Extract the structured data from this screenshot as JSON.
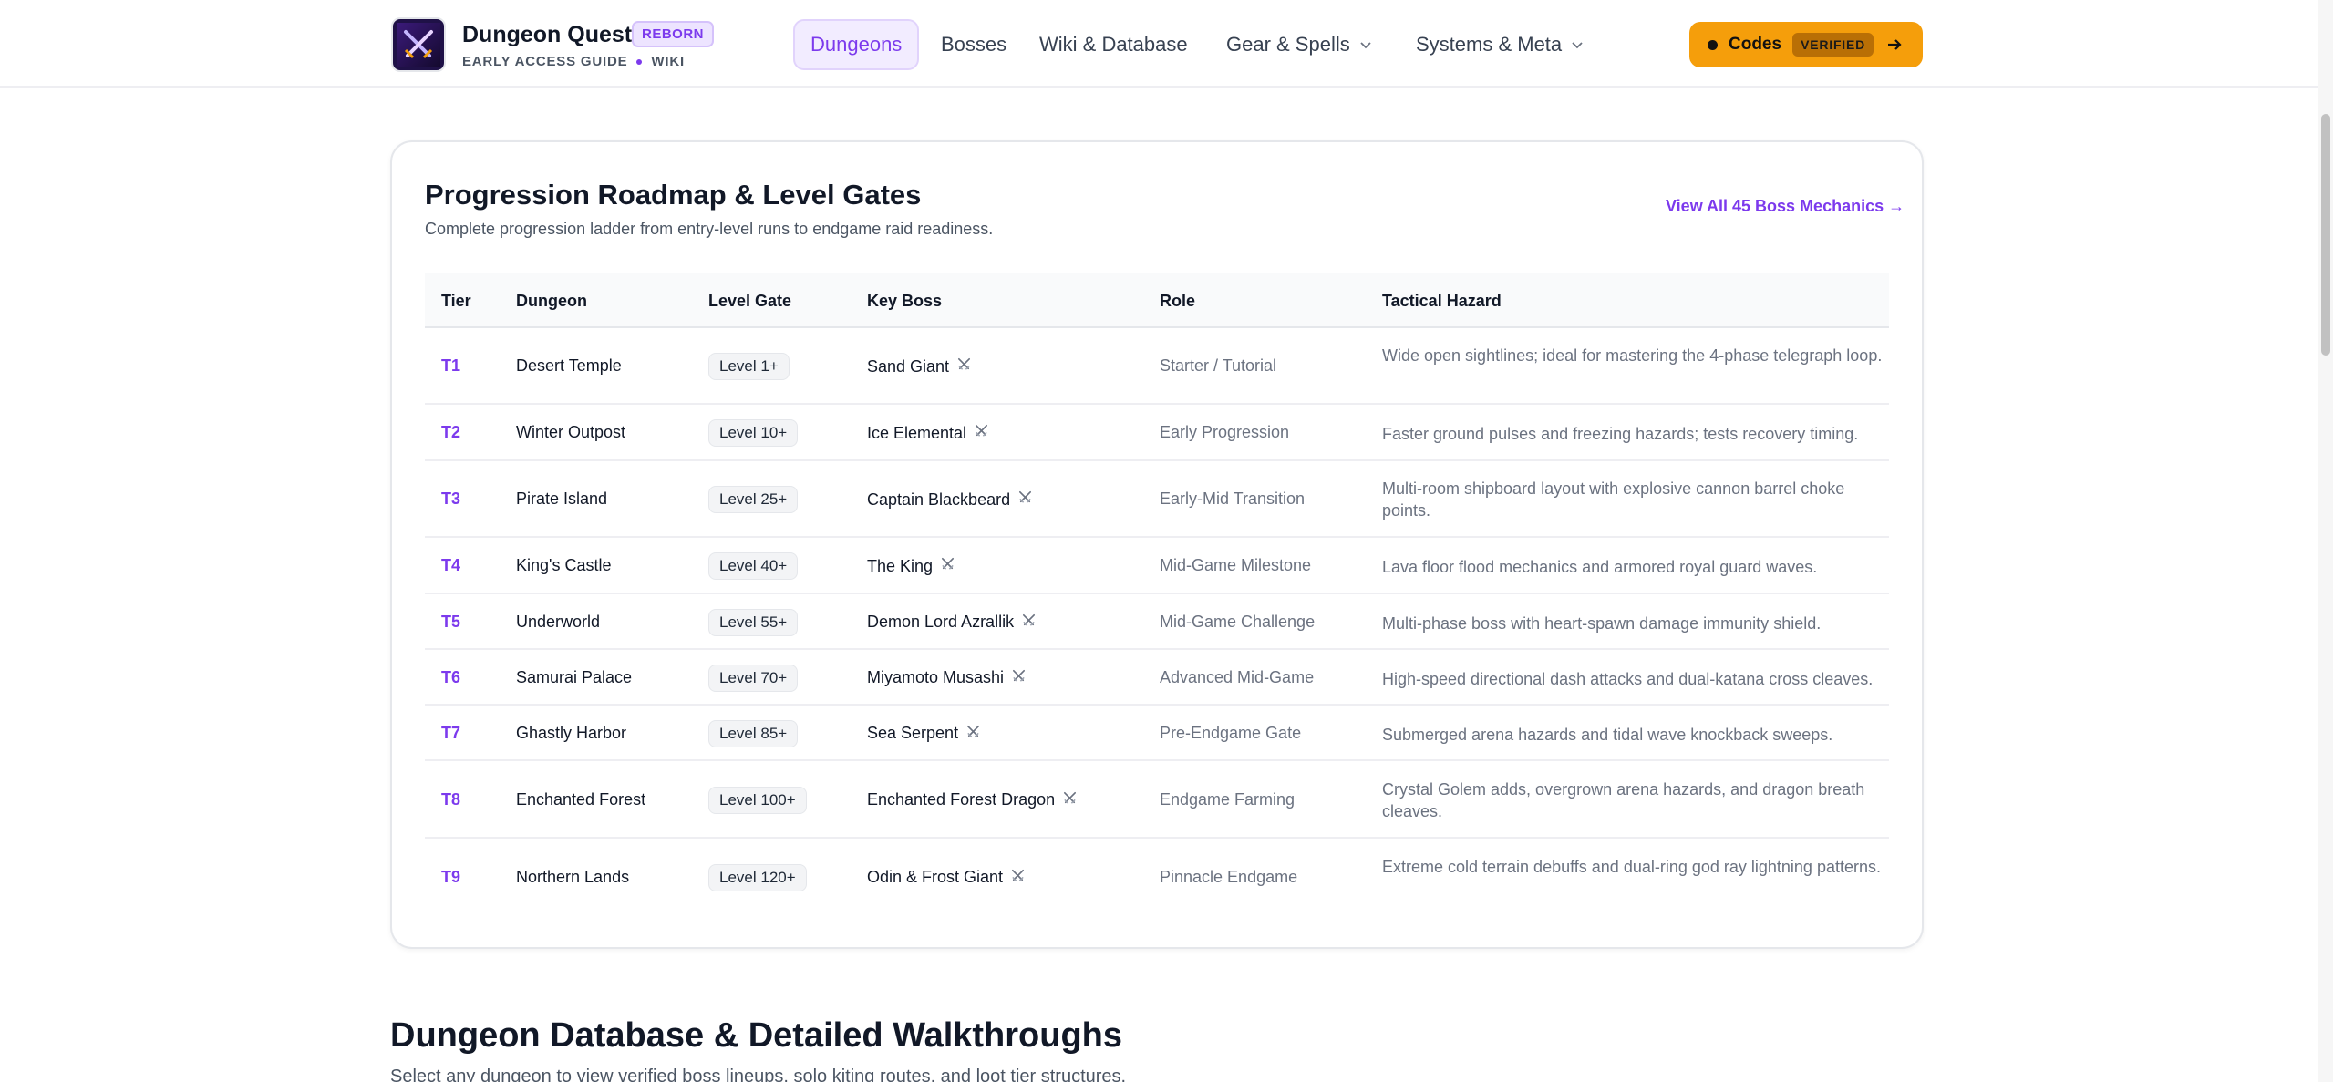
{
  "header": {
    "brand_title": "Dungeon Quest",
    "brand_badge": "REBORN",
    "brand_sub_left": "EARLY ACCESS GUIDE",
    "brand_sub_right": "WIKI",
    "nav": [
      {
        "label": "Dungeons",
        "active": true
      },
      {
        "label": "Bosses"
      },
      {
        "label": "Wiki & Database"
      },
      {
        "label": "Gear & Spells",
        "dropdown": true
      },
      {
        "label": "Systems & Meta",
        "dropdown": true
      }
    ],
    "codes_label": "Codes",
    "codes_badge": "VERIFIED"
  },
  "card": {
    "title": "Progression Roadmap & Level Gates",
    "subtitle": "Complete progression ladder from entry-level runs to endgame raid readiness.",
    "link": "View All 45 Boss Mechanics →",
    "columns": [
      "Tier",
      "Dungeon",
      "Level Gate",
      "Key Boss",
      "Role",
      "Tactical Hazard"
    ],
    "rows": [
      {
        "tier": "T1",
        "dungeon": "Desert Temple",
        "level": "Level 1+",
        "boss": "Sand Giant",
        "role": "Starter / Tutorial",
        "hazard": "Wide open sightlines; ideal for mastering the 4-phase telegraph loop."
      },
      {
        "tier": "T2",
        "dungeon": "Winter Outpost",
        "level": "Level 10+",
        "boss": "Ice Elemental",
        "role": "Early Progression",
        "hazard": "Faster ground pulses and freezing hazards; tests recovery timing."
      },
      {
        "tier": "T3",
        "dungeon": "Pirate Island",
        "level": "Level 25+",
        "boss": "Captain Blackbeard",
        "role": "Early-Mid Transition",
        "hazard": "Multi-room shipboard layout with explosive cannon barrel choke points."
      },
      {
        "tier": "T4",
        "dungeon": "King's Castle",
        "level": "Level 40+",
        "boss": "The King",
        "role": "Mid-Game Milestone",
        "hazard": "Lava floor flood mechanics and armored royal guard waves."
      },
      {
        "tier": "T5",
        "dungeon": "Underworld",
        "level": "Level 55+",
        "boss": "Demon Lord Azrallik",
        "role": "Mid-Game Challenge",
        "hazard": "Multi-phase boss with heart-spawn damage immunity shield."
      },
      {
        "tier": "T6",
        "dungeon": "Samurai Palace",
        "level": "Level 70+",
        "boss": "Miyamoto Musashi",
        "role": "Advanced Mid-Game",
        "hazard": "High-speed directional dash attacks and dual-katana cross cleaves."
      },
      {
        "tier": "T7",
        "dungeon": "Ghastly Harbor",
        "level": "Level 85+",
        "boss": "Sea Serpent",
        "role": "Pre-Endgame Gate",
        "hazard": "Submerged arena hazards and tidal wave knockback sweeps."
      },
      {
        "tier": "T8",
        "dungeon": "Enchanted Forest",
        "level": "Level 100+",
        "boss": "Enchanted Forest Dragon",
        "role": "Endgame Farming",
        "hazard": "Crystal Golem adds, overgrown arena hazards, and dragon breath cleaves."
      },
      {
        "tier": "T9",
        "dungeon": "Northern Lands",
        "level": "Level 120+",
        "boss": "Odin & Frost Giant",
        "role": "Pinnacle Endgame",
        "hazard": "Extreme cold terrain debuffs and dual-ring god ray lightning patterns."
      }
    ]
  },
  "section": {
    "title": "Dungeon Database & Detailed Walkthroughs",
    "subtitle": "Select any dungeon to view verified boss lineups, solo kiting routes, and loot tier structures."
  },
  "colors": {
    "accent": "#7c3aed",
    "codes_button": "#f59e0b",
    "text_primary": "#111827",
    "text_muted": "#6b7280"
  }
}
